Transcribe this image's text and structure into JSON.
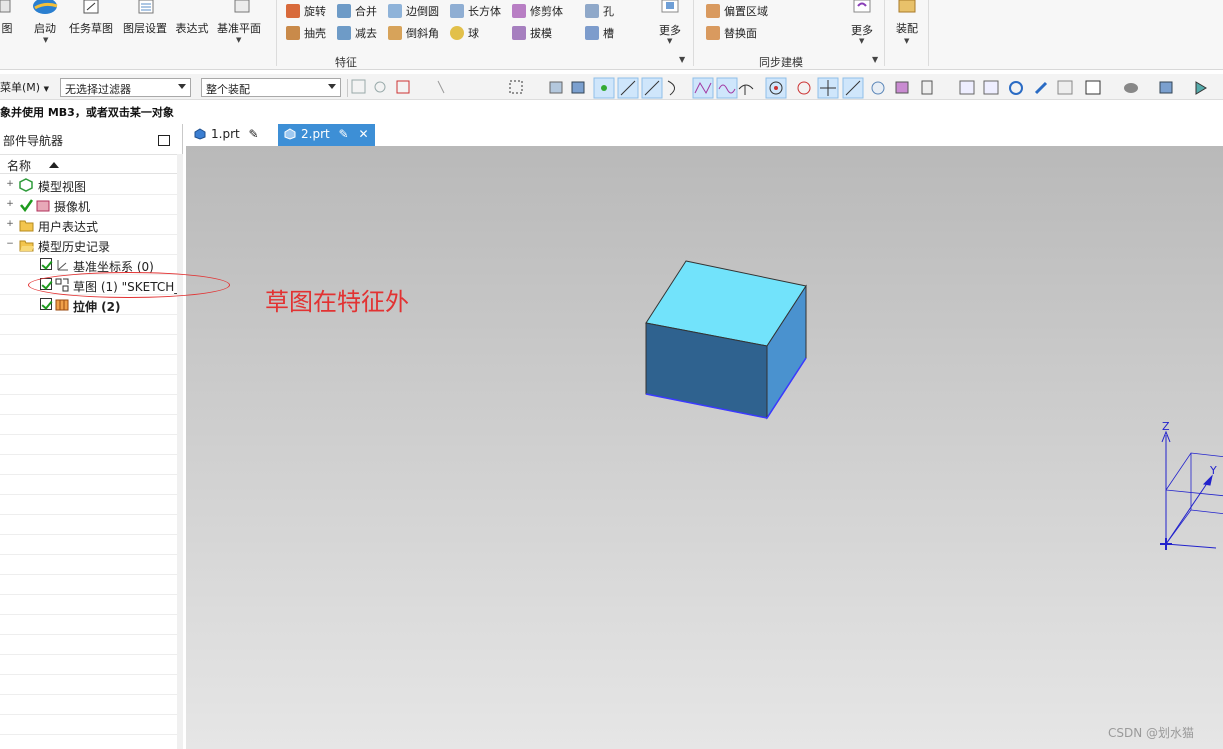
{
  "ribbon": {
    "big_buttons": [
      {
        "label": "图",
        "icon": "view-icon"
      },
      {
        "label": "启动",
        "icon": "start-icon"
      },
      {
        "label": "任务草图",
        "icon": "sketch-task-icon"
      },
      {
        "label": "图层设置",
        "icon": "layer-settings-icon"
      },
      {
        "label": "表达式",
        "icon": "expression-icon"
      },
      {
        "label": "基准平面",
        "icon": "datum-plane-icon"
      }
    ],
    "feature_small": [
      {
        "label": "旋转",
        "icon": "revolve-icon"
      },
      {
        "label": "抽壳",
        "icon": "shell-icon"
      },
      {
        "label": "合并",
        "icon": "unite-icon"
      },
      {
        "label": "减去",
        "icon": "subtract-icon"
      },
      {
        "label": "边倒圆",
        "icon": "edge-blend-icon"
      },
      {
        "label": "倒斜角",
        "icon": "chamfer-icon"
      },
      {
        "label": "长方体",
        "icon": "block-icon"
      },
      {
        "label": "球",
        "icon": "sphere-icon"
      },
      {
        "label": "修剪体",
        "icon": "trim-body-icon"
      },
      {
        "label": "拔模",
        "icon": "draft-icon"
      },
      {
        "label": "孔",
        "icon": "hole-icon"
      },
      {
        "label": "槽",
        "icon": "groove-icon"
      }
    ],
    "feature_more": "更多",
    "feature_group": "特征",
    "sync_small": [
      {
        "label": "偏置区域",
        "icon": "offset-region-icon"
      },
      {
        "label": "替换面",
        "icon": "replace-face-icon"
      }
    ],
    "sync_more": "更多",
    "sync_group": "同步建模",
    "assembly": "装配"
  },
  "toolbar": {
    "menu": "菜单(M)",
    "filter": "无选择过滤器",
    "scope": "整个装配"
  },
  "status": "象并使用 MB3，或者双击某一对象",
  "navigator": {
    "title": "部件导航器",
    "column": "名称",
    "items": [
      {
        "label": "模型视图",
        "icon": "model-views-icon",
        "expand": "+"
      },
      {
        "label": "摄像机",
        "icon": "camera-icon",
        "expand": "+"
      },
      {
        "label": "用户表达式",
        "icon": "folder-icon",
        "expand": "+"
      },
      {
        "label": "模型历史记录",
        "icon": "folder-open-icon",
        "expand": "−"
      },
      {
        "label": "基准坐标系 (0)",
        "icon": "datum-csys-icon"
      },
      {
        "label": "草图 (1) \"SKETCH_",
        "icon": "sketch-icon"
      },
      {
        "label": "拉伸 (2)",
        "icon": "extrude-icon"
      }
    ]
  },
  "tabs": [
    {
      "label": "1.prt"
    },
    {
      "label": "2.prt"
    }
  ],
  "annotation": "草图在特征外",
  "axes": {
    "z": "Z",
    "y": "Y"
  },
  "watermark": "CSDN @划水猫",
  "colors": {
    "cube_top": "#72e3fb",
    "cube_front": "#2f628f",
    "cube_side": "#4a92cf",
    "annotation": "#e23232",
    "tab_active": "#3d8fd6"
  }
}
